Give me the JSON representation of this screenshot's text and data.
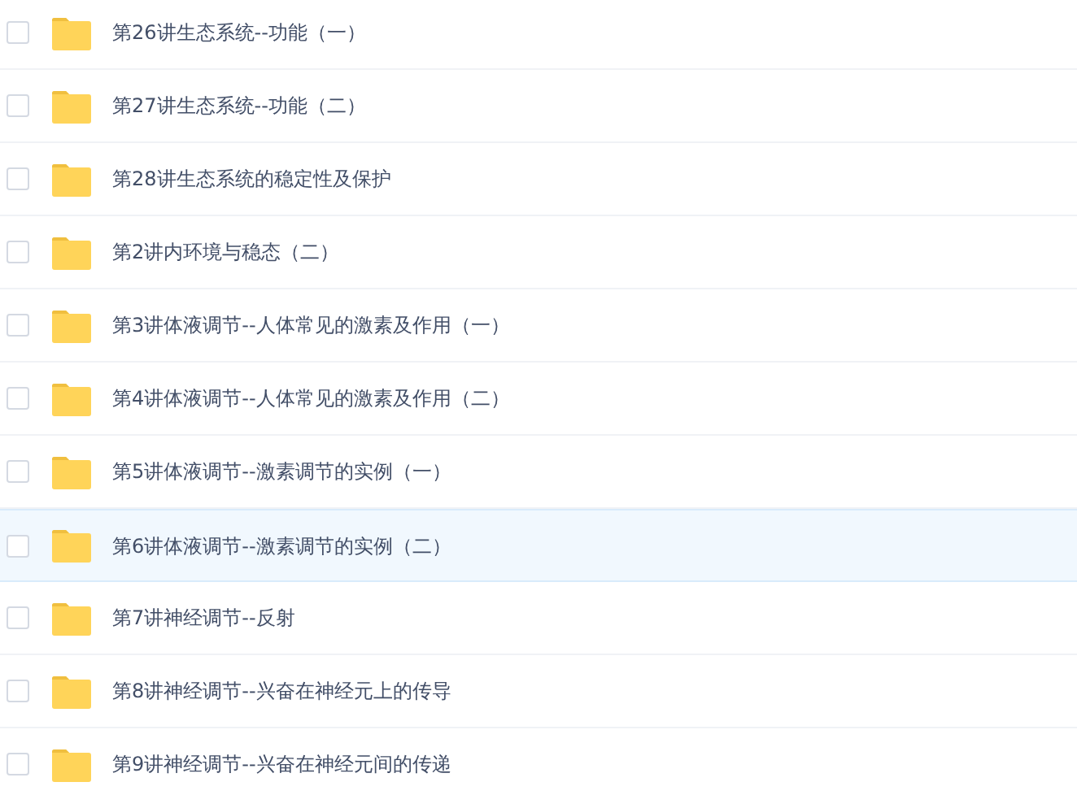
{
  "files": [
    {
      "name": "第26讲生态系统--功能（一）",
      "checked": false,
      "highlighted": false
    },
    {
      "name": "第27讲生态系统--功能（二）",
      "checked": false,
      "highlighted": false
    },
    {
      "name": "第28讲生态系统的稳定性及保护",
      "checked": false,
      "highlighted": false
    },
    {
      "name": "第2讲内环境与稳态（二）",
      "checked": false,
      "highlighted": false
    },
    {
      "name": "第3讲体液调节--人体常见的激素及作用（一）",
      "checked": false,
      "highlighted": false
    },
    {
      "name": "第4讲体液调节--人体常见的激素及作用（二）",
      "checked": false,
      "highlighted": false
    },
    {
      "name": "第5讲体液调节--激素调节的实例（一）",
      "checked": false,
      "highlighted": false
    },
    {
      "name": "第6讲体液调节--激素调节的实例（二）",
      "checked": false,
      "highlighted": true
    },
    {
      "name": "第7讲神经调节--反射",
      "checked": false,
      "highlighted": false
    },
    {
      "name": "第8讲神经调节--兴奋在神经元上的传导",
      "checked": false,
      "highlighted": false
    },
    {
      "name": "第9讲神经调节--兴奋在神经元间的传递",
      "checked": false,
      "highlighted": false
    }
  ]
}
